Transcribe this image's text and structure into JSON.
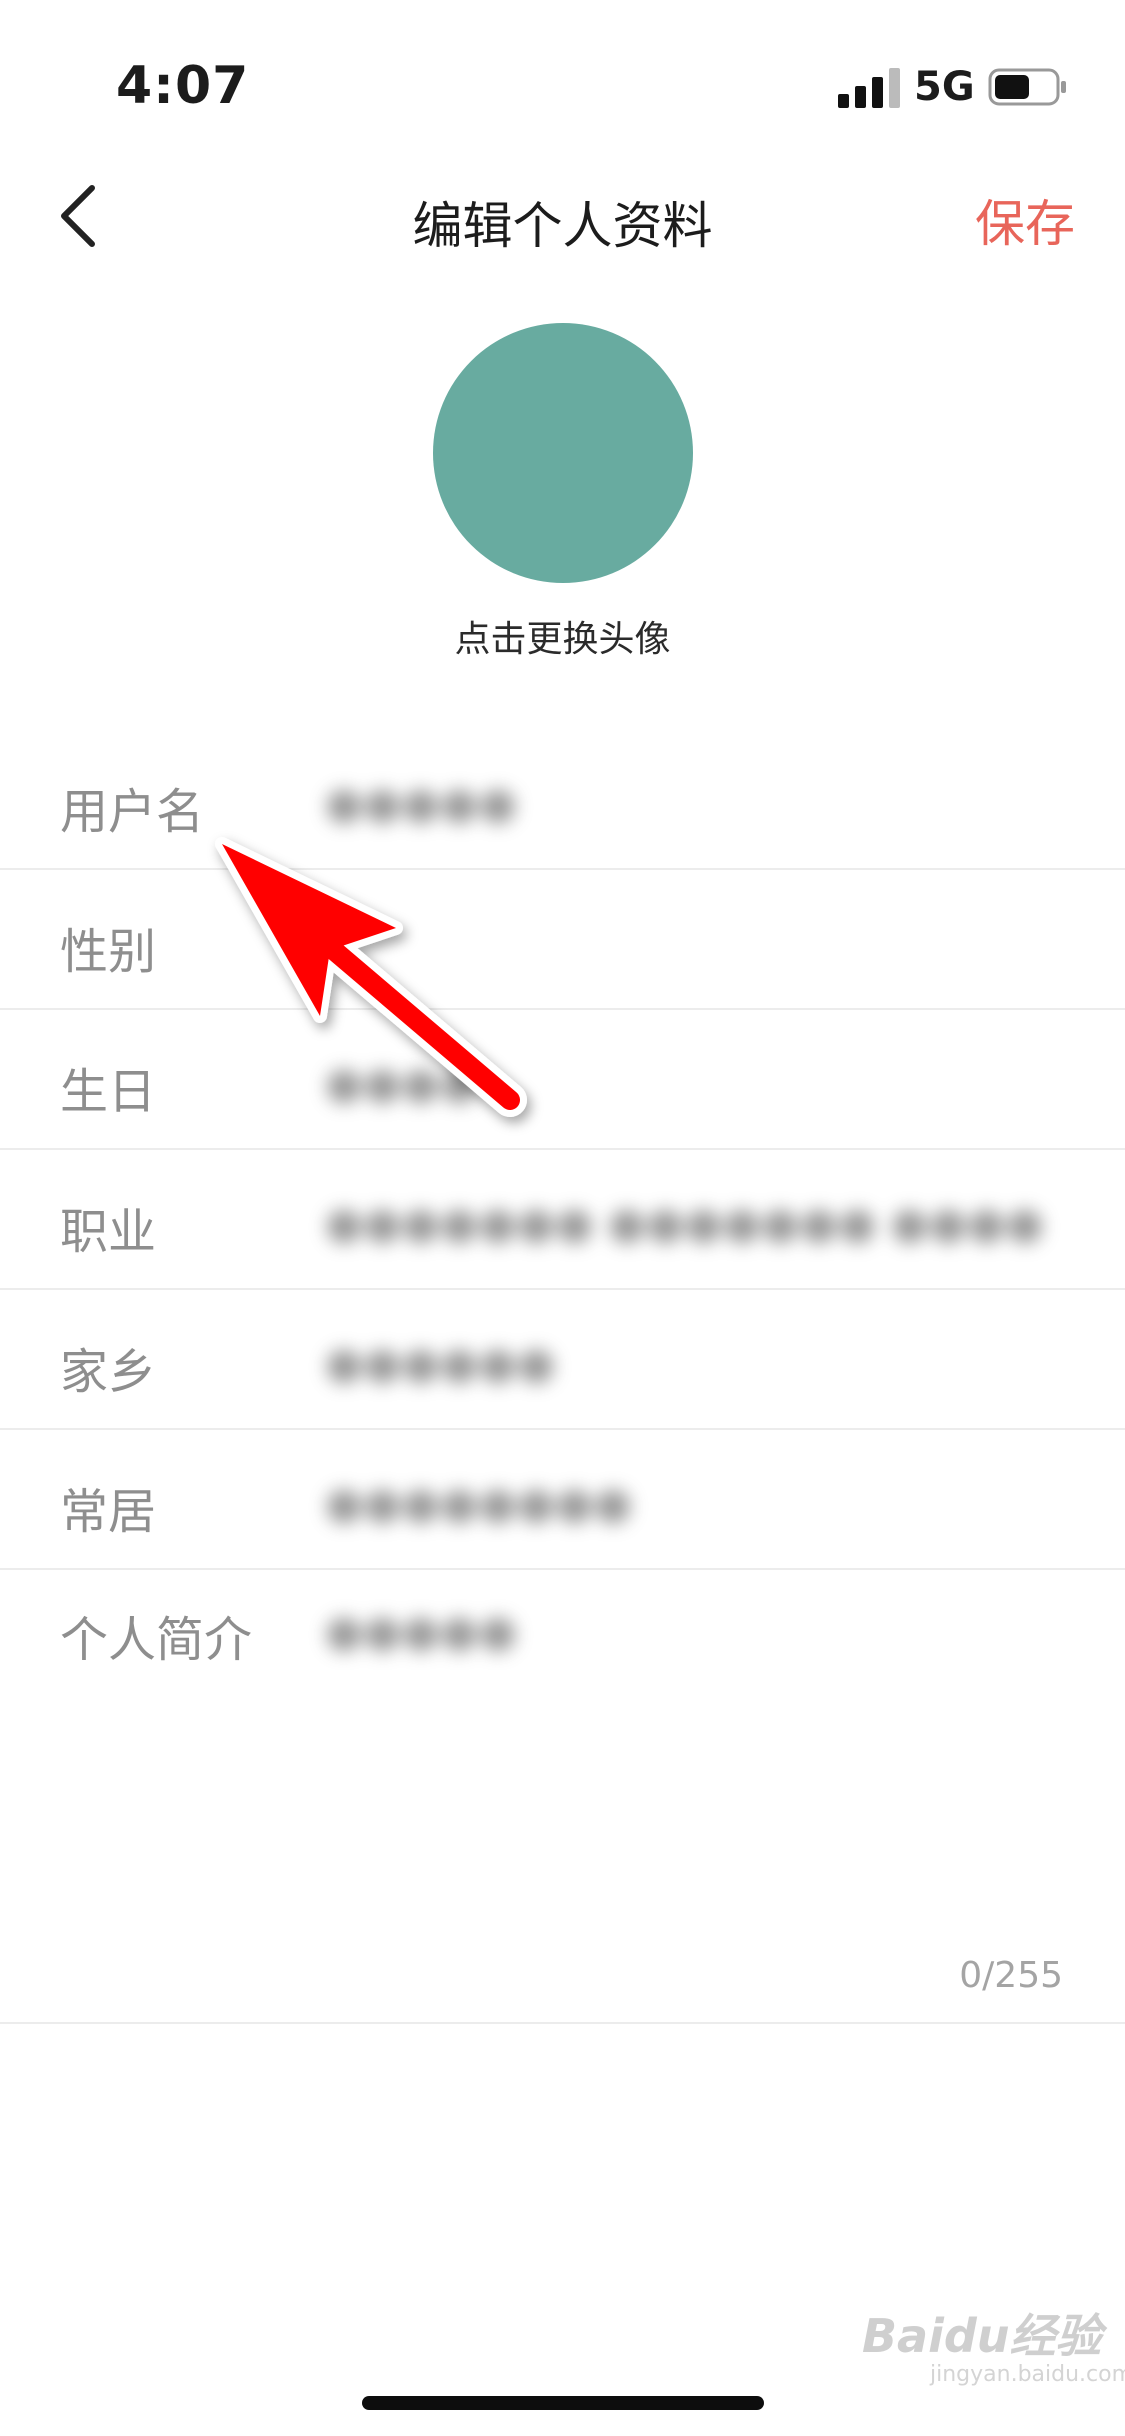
{
  "status_bar": {
    "time": "4:07",
    "network": "5G"
  },
  "nav": {
    "title": "编辑个人资料",
    "save_label": "保存"
  },
  "avatar": {
    "hint": "点击更换头像",
    "color": "#68aba0"
  },
  "form": {
    "fields": [
      {
        "label": "用户名",
        "value": "●●●●●"
      },
      {
        "label": "性别",
        "value": ""
      },
      {
        "label": "生日",
        "value": "●●●●"
      },
      {
        "label": "职业",
        "value": "●●●●●●● ●●●●●●● ●●●●"
      },
      {
        "label": "家乡",
        "value": "●●●●●●"
      },
      {
        "label": "常居",
        "value": "●●●●●●●●"
      }
    ],
    "bio": {
      "label": "个人简介",
      "value": "●●●●●",
      "counter": "0/255"
    }
  },
  "watermark": {
    "brand": "Baidu经验",
    "url": "jingyan.baidu.com"
  },
  "colors": {
    "accent": "#e8655a",
    "annotation_arrow": "#ff0000"
  }
}
